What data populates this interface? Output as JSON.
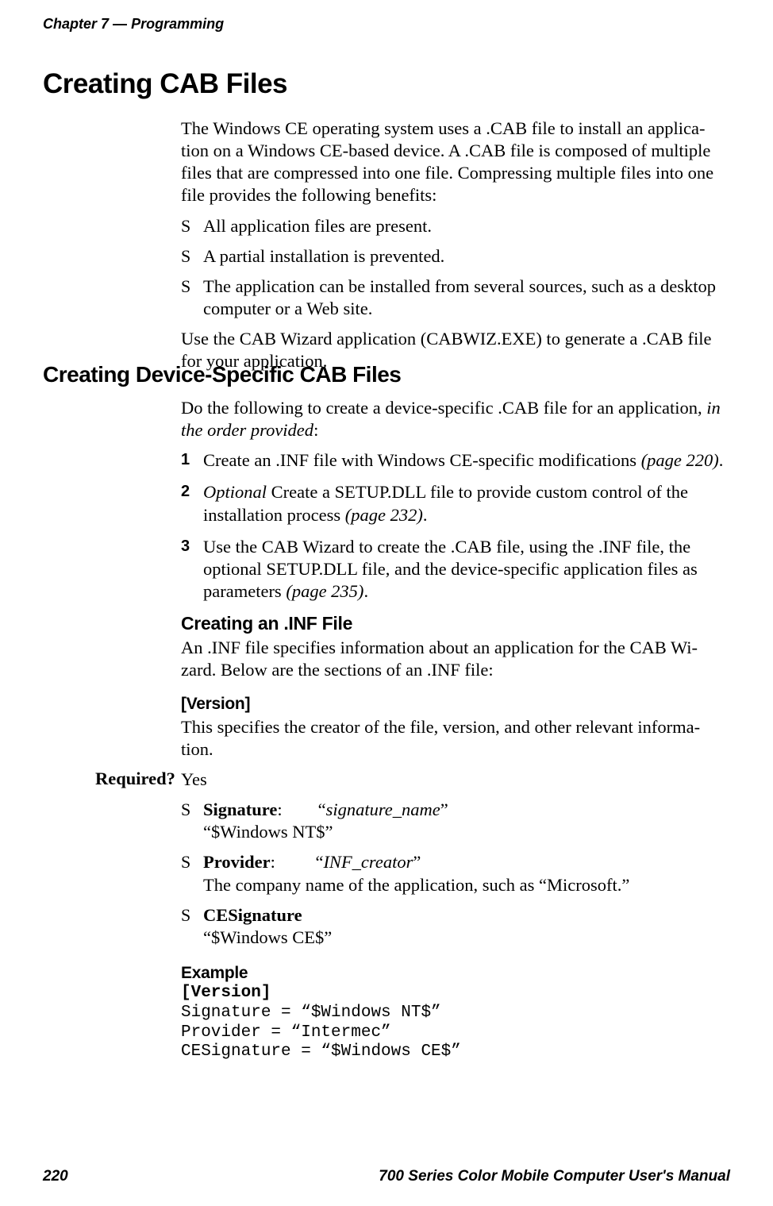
{
  "header": {
    "chapter": "Chapter 7",
    "separator": "—",
    "section": "Programming"
  },
  "h1": "Creating CAB Files",
  "intro": "The Windows CE operating system uses a .CAB file to install an applica-\ntion on a Windows CE-based device. A .CAB file is composed of multiple\nfiles that are compressed into one file. Compressing multiple files into one\nfile provides the following benefits:",
  "bullets": [
    "All application files are present.",
    "A partial installation is prevented.",
    "The application can be installed from several sources, such as a desktop computer or a Web site."
  ],
  "after_bullets": "Use the CAB Wizard application (CABWIZ.EXE) to generate a .CAB file for your application.",
  "h2": "Creating Device-Specific CAB Files",
  "h2_intro_pre": "Do the following to create a device-specific .CAB file for an application, ",
  "h2_intro_it": "in the order provided",
  "h2_intro_post": ":",
  "steps": [
    {
      "pre": "Create an .INF file with Windows CE-specific modifications ",
      "ref": "(page 220)",
      "post": "."
    },
    {
      "optional": "Optional",
      "pre": " Create a SETUP.DLL file to provide custom control of the installation process ",
      "ref": "(page 232)",
      "post": "."
    },
    {
      "pre": "Use the CAB Wizard to create the .CAB file, using the .INF file, the optional SETUP.DLL file, and the device-specific application files as parameters ",
      "ref": "(page 235)",
      "post": "."
    }
  ],
  "h3": "Creating an .INF File",
  "h3_body": "An .INF file specifies information about an application for the CAB Wi-\nzard. Below are the sections of an .INF file:",
  "h4_version": "[Version]",
  "version_body": "This specifies the creator of the file, version, and other relevant informa-\ntion.",
  "required_label": "Required?",
  "required_value": "Yes",
  "version_items": [
    {
      "name": "Signature",
      "value_it": "signature_name",
      "body": "“$Windows NT$”"
    },
    {
      "name": "Provider",
      "value_it": "INF_creator",
      "body": "The company name of the application, such as “Microsoft.”"
    },
    {
      "name": "CESignature",
      "body": "“$Windows CE$”"
    }
  ],
  "h4_example": "Example",
  "example_code_head": "[Version]",
  "example_code_body": "Signature = “$Windows NT$”\nProvider = “Intermec”\nCESignature = “$Windows CE$”",
  "footer": {
    "page": "220",
    "title": "700 Series Color Mobile Computer User's Manual"
  }
}
